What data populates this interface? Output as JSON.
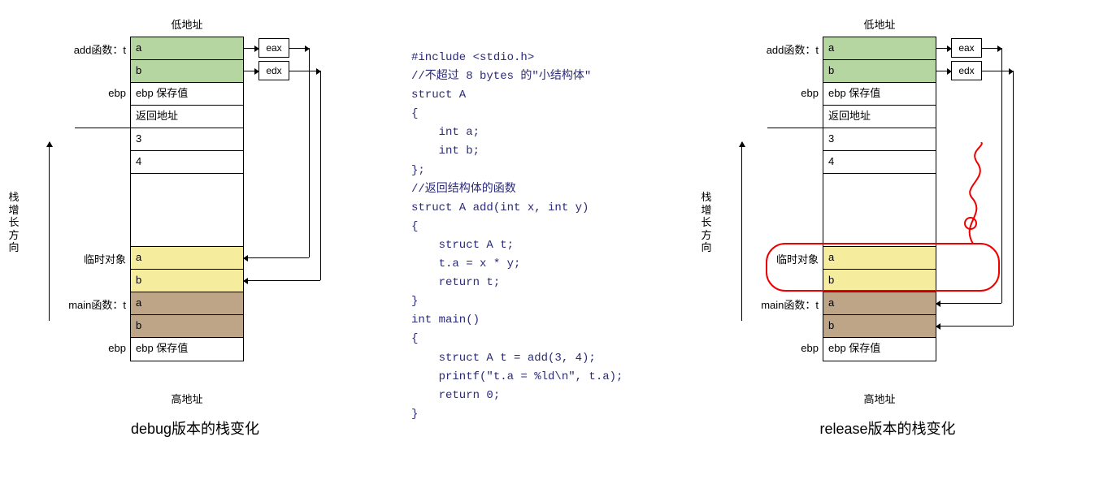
{
  "labels": {
    "low_addr": "低地址",
    "high_addr": "高地址",
    "add_func_t": "add函数：t",
    "ebp": "ebp",
    "temp_obj": "临时对象",
    "main_func_t": "main函数：t",
    "growth": "栈增长方向"
  },
  "captions": {
    "debug": "debug版本的栈变化",
    "release": "release版本的栈变化"
  },
  "cells": {
    "a": "a",
    "b": "b",
    "ebp_saved": "ebp 保存值",
    "ret_addr": "返回地址",
    "three": "3",
    "four": "4"
  },
  "regs": {
    "eax": "eax",
    "edx": "edx"
  },
  "code": "#include <stdio.h>\n//不超过 8 bytes 的\"小结构体\"\nstruct A\n{\n    int a;\n    int b;\n};\n//返回结构体的函数\nstruct A add(int x, int y)\n{\n    struct A t;\n    t.a = x * y;\n    return t;\n}\nint main()\n{\n    struct A t = add(3, 4);\n    printf(\"t.a = %ld\\n\", t.a);\n    return 0;\n}"
}
